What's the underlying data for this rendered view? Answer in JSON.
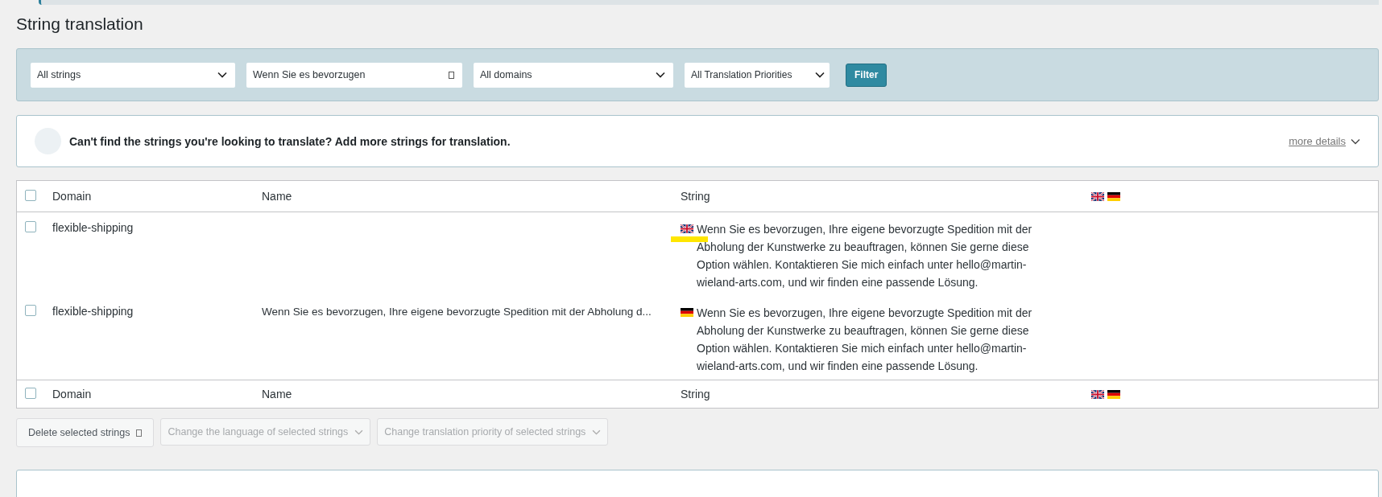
{
  "page_title": "String translation",
  "filters": {
    "selects": [
      {
        "value": "All strings"
      },
      {
        "kind": "search",
        "value": "Wenn Sie es bevorzugen"
      },
      {
        "value": "All domains"
      },
      {
        "value": "All Translation Priorities"
      }
    ],
    "button": "Filter"
  },
  "notice": {
    "text": "Can't find the strings you're looking to translate? Add more strings for translation.",
    "link": "more details"
  },
  "table": {
    "columns": [
      "Domain",
      "Name",
      "String"
    ],
    "languages": [
      {
        "kind": "en"
      },
      {
        "kind": "de"
      }
    ],
    "header_checked": false,
    "footer": {
      "columns": [
        "Domain",
        "Name",
        "String"
      ],
      "languages": [
        {
          "kind": "en"
        },
        {
          "kind": "de"
        }
      ],
      "checked": false
    },
    "rows": [
      {
        "checked": false,
        "domain": "flexible-shipping",
        "name": "",
        "flag": {
          "kind": "en"
        },
        "string": "Wenn Sie es bevorzugen, Ihre eigene bevorzugte Spedition mit der Abholung der Kunstwerke zu beauftragen, können Sie gerne diese Option wählen. Kontaktieren Sie mich einfach unter hello@martin-wieland-arts.com, und wir finden eine passende Lösung."
      },
      {
        "checked": false,
        "domain": "flexible-shipping",
        "name": "Wenn Sie es bevorzugen, Ihre eigene bevorzugte Spedition mit der Abholung d...",
        "flag": {
          "kind": "de"
        },
        "string": "Wenn Sie es bevorzugen, Ihre eigene bevorzugte Spedition mit der Abholung der Kunstwerke zu beauftragen, können Sie gerne diese Option wählen. Kontaktieren Sie mich einfach unter hello@martin-wieland-arts.com, und wir finden eine passende Lösung."
      }
    ]
  },
  "bulk_actions": [
    {
      "kind": "button",
      "label": "Delete selected strings",
      "disabled": false
    },
    {
      "kind": "select",
      "label": "Change the language of selected strings",
      "disabled": true
    },
    {
      "kind": "select",
      "label": "Change translation priority of selected strings",
      "disabled": true
    }
  ]
}
